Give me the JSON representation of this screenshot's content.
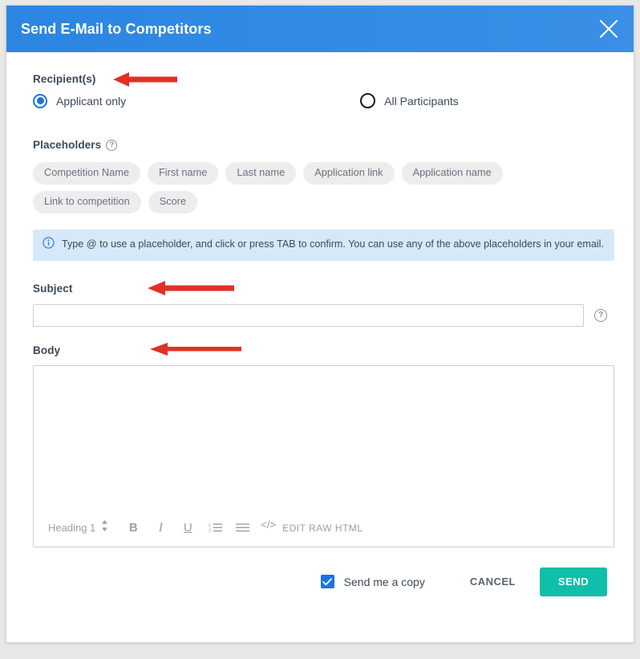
{
  "dialog": {
    "title": "Send E-Mail to Competitors",
    "close_icon": "close-icon",
    "header_color": "#2b87e3"
  },
  "recipients": {
    "label": "Recipient(s)",
    "options": [
      {
        "label": "Applicant only",
        "selected": true
      },
      {
        "label": "All Participants",
        "selected": false
      }
    ]
  },
  "placeholders": {
    "label": "Placeholders",
    "help_icon": "help-circle-icon",
    "chips": [
      "Competition Name",
      "First name",
      "Last name",
      "Application link",
      "Application name",
      "Link to competition",
      "Score"
    ]
  },
  "info": {
    "icon": "info-circle-icon",
    "text": "Type @ to use a placeholder, and click or press TAB to confirm. You can use any of the above placeholders in your email.",
    "background": "#d6e9fb"
  },
  "subject": {
    "label": "Subject",
    "value": "",
    "placeholder": "",
    "help_icon": "help-circle-icon"
  },
  "body": {
    "label": "Body",
    "value": "",
    "placeholder": "",
    "toolbar": {
      "heading_value": "Heading 1",
      "stepper_icon": "up-down-arrows-icon",
      "bold_label": "B",
      "italic_label": "I",
      "underline_label": "U",
      "ordered_list_icon": "ordered-list-icon",
      "unordered_list_icon": "unordered-list-icon",
      "code_label": "</>",
      "raw_html_label": "EDIT RAW HTML"
    }
  },
  "footer": {
    "send_copy_label": "Send me a copy",
    "send_copy_checked": true,
    "cancel_label": "CANCEL",
    "send_label": "SEND",
    "send_color": "#0fbfa9"
  },
  "annotations": {
    "arrow_color": "#e03127",
    "arrows": [
      {
        "name": "recipients-arrow",
        "points_to": "Recipient(s)"
      },
      {
        "name": "subject-arrow",
        "points_to": "Subject"
      },
      {
        "name": "body-arrow",
        "points_to": "Body"
      }
    ]
  }
}
